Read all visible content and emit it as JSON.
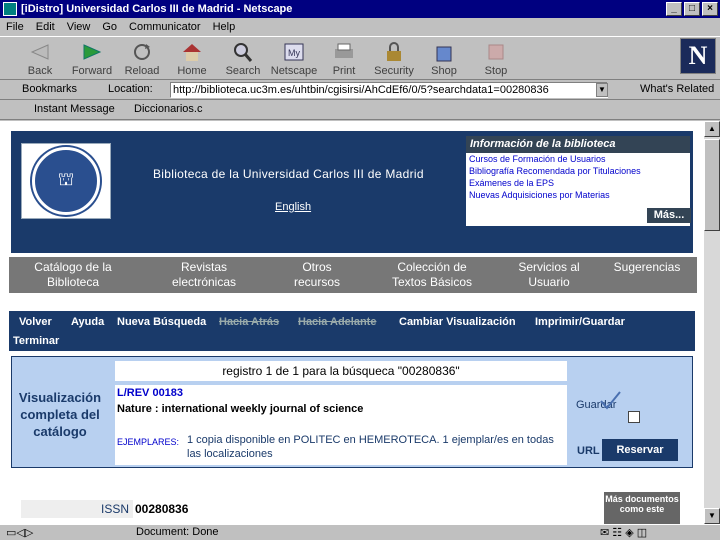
{
  "window": {
    "title": "[iDistro] Universidad Carlos III de Madrid - Netscape",
    "buttons": [
      "_",
      "□",
      "×"
    ]
  },
  "menu": [
    "File",
    "Edit",
    "View",
    "Go",
    "Communicator",
    "Help"
  ],
  "toolbar": [
    "Back",
    "Forward",
    "Reload",
    "Home",
    "Search",
    "Netscape",
    "Print",
    "Security",
    "Shop",
    "Stop"
  ],
  "location": {
    "bookmarks": "Bookmarks",
    "label": "Location:",
    "url": "http://biblioteca.uc3m.es/uhtbin/cgisirsi/AhCdEf6/0/5?searchdata1=00280836",
    "related": "What's Related"
  },
  "personal": {
    "instant": "Instant Message",
    "dic": "Diccionarios.c"
  },
  "header": {
    "title": "Biblioteca de la Universidad Carlos III de Madrid",
    "english": "English",
    "info_title": "Información de la biblioteca",
    "info_links": [
      "Cursos de Formación de Usuarios",
      "Bibliografía Recomendada por Titulaciones",
      "Exámenes de la EPS",
      "Nuevas Adquisiciones por Materias"
    ],
    "mas": "Más..."
  },
  "nav": [
    {
      "l1": "Catálogo de la",
      "l2": "Biblioteca"
    },
    {
      "l1": "Revistas",
      "l2": "electrónicas"
    },
    {
      "l1": "Otros",
      "l2": "recursos"
    },
    {
      "l1": "Colección de",
      "l2": "Textos Básicos"
    },
    {
      "l1": "Servicios al",
      "l2": "Usuario"
    },
    {
      "l1": "Sugerencias",
      "l2": ""
    }
  ],
  "actions": {
    "volver": "Volver",
    "ayuda": "Ayuda",
    "nueva": "Nueva Búsqueda",
    "atras": "Hacia Atrás",
    "adelante": "Hacia Adelante",
    "cambiar": "Cambiar Visualización",
    "imprimir": "Imprimir/Guardar",
    "terminar": "Terminar"
  },
  "result": {
    "vc_l1": "Visualización",
    "vc_l2": "completa del",
    "vc_l3": "catálogo",
    "registro": "registro 1 de 1 para la búsqueca \"00280836\"",
    "call": "L/REV 00183",
    "jtitle": "Nature : international weekly journal of science",
    "ej_label": "EJEMPLARES:",
    "ej_text": "1 copia disponible en POLITEC en HEMEROTECA.    1 ejemplar/es en todas las localizaciones",
    "guardar": "Guardar",
    "url": "URL",
    "reservar": "Reservar",
    "issn_label": "ISSN",
    "issn_value": "00280836",
    "masdoc": "Más documentos como este"
  },
  "status": {
    "text": "Document: Done"
  }
}
